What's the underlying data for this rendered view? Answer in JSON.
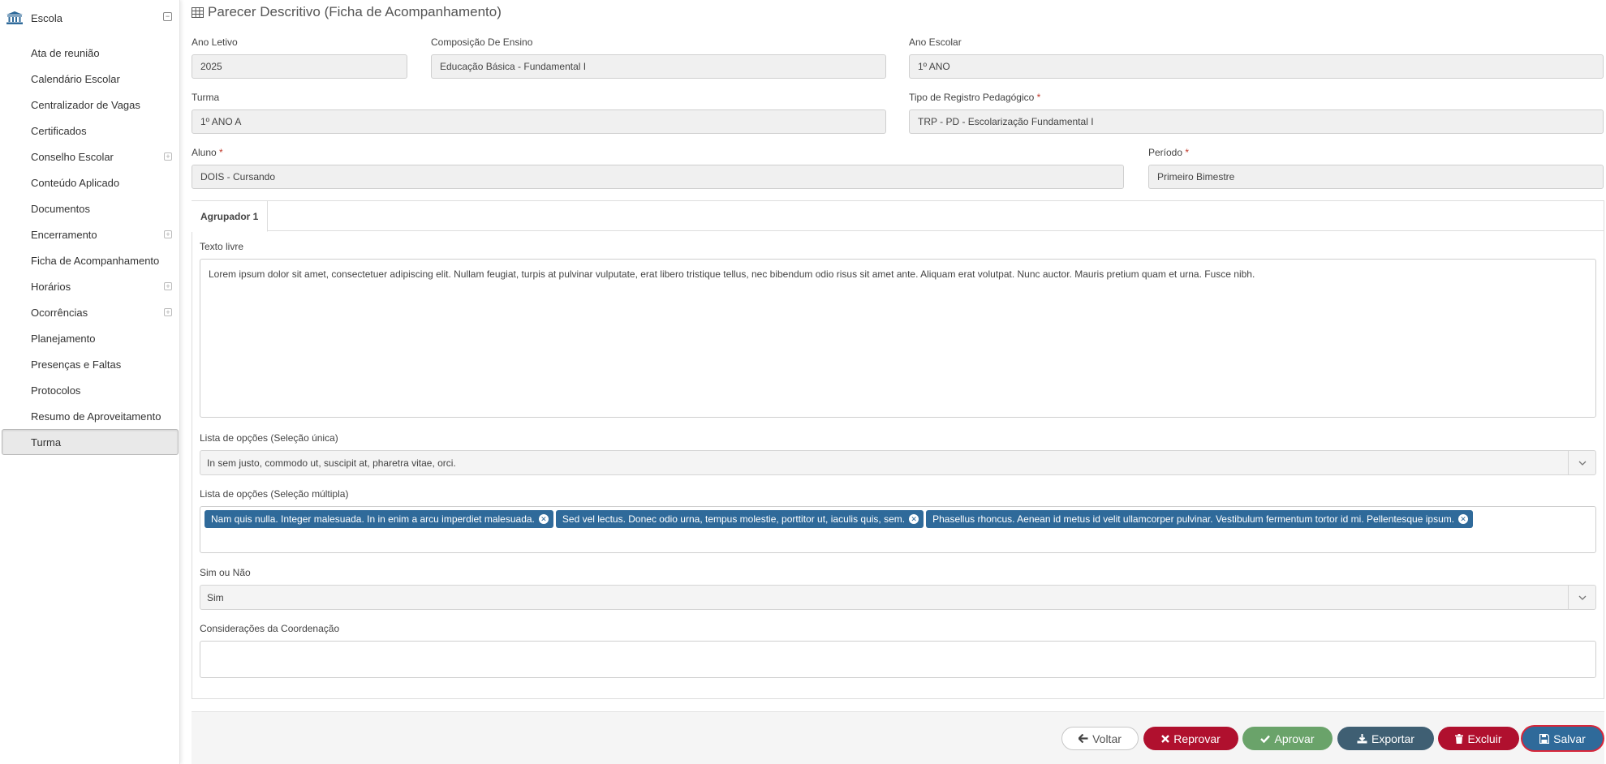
{
  "sidebar": {
    "header": "Escola",
    "items": [
      {
        "label": "Ata de reunião",
        "expandable": false
      },
      {
        "label": "Calendário Escolar",
        "expandable": false
      },
      {
        "label": "Centralizador de Vagas",
        "expandable": false
      },
      {
        "label": "Certificados",
        "expandable": false
      },
      {
        "label": "Conselho Escolar",
        "expandable": true
      },
      {
        "label": "Conteúdo Aplicado",
        "expandable": false
      },
      {
        "label": "Documentos",
        "expandable": false
      },
      {
        "label": "Encerramento",
        "expandable": true
      },
      {
        "label": "Ficha de Acompanhamento",
        "expandable": false
      },
      {
        "label": "Horários",
        "expandable": true
      },
      {
        "label": "Ocorrências",
        "expandable": true
      },
      {
        "label": "Planejamento",
        "expandable": false
      },
      {
        "label": "Presenças e Faltas",
        "expandable": false
      },
      {
        "label": "Protocolos",
        "expandable": false
      },
      {
        "label": "Resumo de Aproveitamento",
        "expandable": false
      },
      {
        "label": "Turma",
        "expandable": false,
        "active": true
      }
    ]
  },
  "page": {
    "title": "Parecer Descritivo (Ficha de Acompanhamento)"
  },
  "form": {
    "ano_letivo": {
      "label": "Ano Letivo",
      "value": "2025"
    },
    "composicao": {
      "label": "Composição De Ensino",
      "value": "Educação Básica - Fundamental I"
    },
    "ano_escolar": {
      "label": "Ano Escolar",
      "value": "1º ANO"
    },
    "turma": {
      "label": "Turma",
      "value": "1º ANO A"
    },
    "tipo_registro": {
      "label": "Tipo de Registro Pedagógico",
      "required": "*",
      "value": "TRP - PD - Escolarização Fundamental I"
    },
    "aluno": {
      "label": "Aluno",
      "required": "*",
      "value": "DOIS - Cursando"
    },
    "periodo": {
      "label": "Período",
      "required": "*",
      "value": "Primeiro Bimestre"
    }
  },
  "tabs": [
    {
      "label": "Agrupador 1",
      "active": true
    }
  ],
  "agrupador": {
    "texto_livre": {
      "label": "Texto livre",
      "value": "Lorem ipsum dolor sit amet, consectetuer adipiscing elit. Nullam feugiat, turpis at pulvinar vulputate, erat libero tristique tellus, nec bibendum odio risus sit amet ante. Aliquam erat volutpat. Nunc auctor. Mauris pretium quam et urna. Fusce nibh."
    },
    "selecao_unica": {
      "label": "Lista de opções (Seleção única)",
      "value": "In sem justo, commodo ut, suscipit at, pharetra vitae, orci."
    },
    "selecao_multipla": {
      "label": "Lista de opções (Seleção múltipla)",
      "chips": [
        "Nam quis nulla. Integer malesuada. In in enim a arcu imperdiet malesuada.",
        "Sed vel lectus. Donec odio urna, tempus molestie, porttitor ut, iaculis quis, sem.",
        "Phasellus rhoncus. Aenean id metus id velit ullamcorper pulvinar. Vestibulum fermentum tortor id mi. Pellentesque ipsum."
      ]
    },
    "sim_nao": {
      "label": "Sim ou Não",
      "value": "Sim"
    },
    "consideracoes": {
      "label": "Considerações da Coordenação",
      "value": ""
    }
  },
  "footer": {
    "voltar": "Voltar",
    "reprovar": "Reprovar",
    "aprovar": "Aprovar",
    "exportar": "Exportar",
    "excluir": "Excluir",
    "salvar": "Salvar"
  },
  "colors": {
    "primary": "#2f6a9a",
    "danger": "#b0102e",
    "success": "#6aa36a",
    "dark": "#3f5f73"
  }
}
